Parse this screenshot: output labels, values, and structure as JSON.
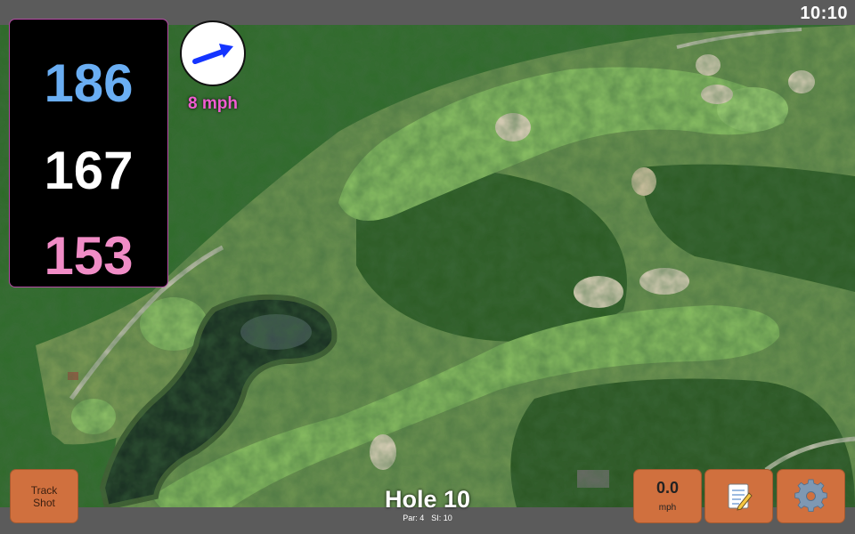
{
  "status_bar": {
    "time": "10:10"
  },
  "distances": {
    "back": "186",
    "middle": "167",
    "front": "153",
    "colors": {
      "back": "#6aaef3",
      "middle": "#ffffff",
      "front": "#f08cc6"
    }
  },
  "wind": {
    "speed_label": "8 mph",
    "icon": "wind-arrow-icon"
  },
  "buttons": {
    "track_shot": {
      "line1": "Track",
      "line2": "Shot"
    },
    "speed": {
      "value": "0.0",
      "unit": "mph"
    },
    "notes_icon": "notepad-icon",
    "settings_icon": "gear-icon"
  },
  "hole": {
    "title": "Hole 10",
    "par": "Par: 4",
    "si": "SI: 10"
  },
  "colors": {
    "accent": "#d0703e",
    "wind_text": "#f05cd1"
  }
}
